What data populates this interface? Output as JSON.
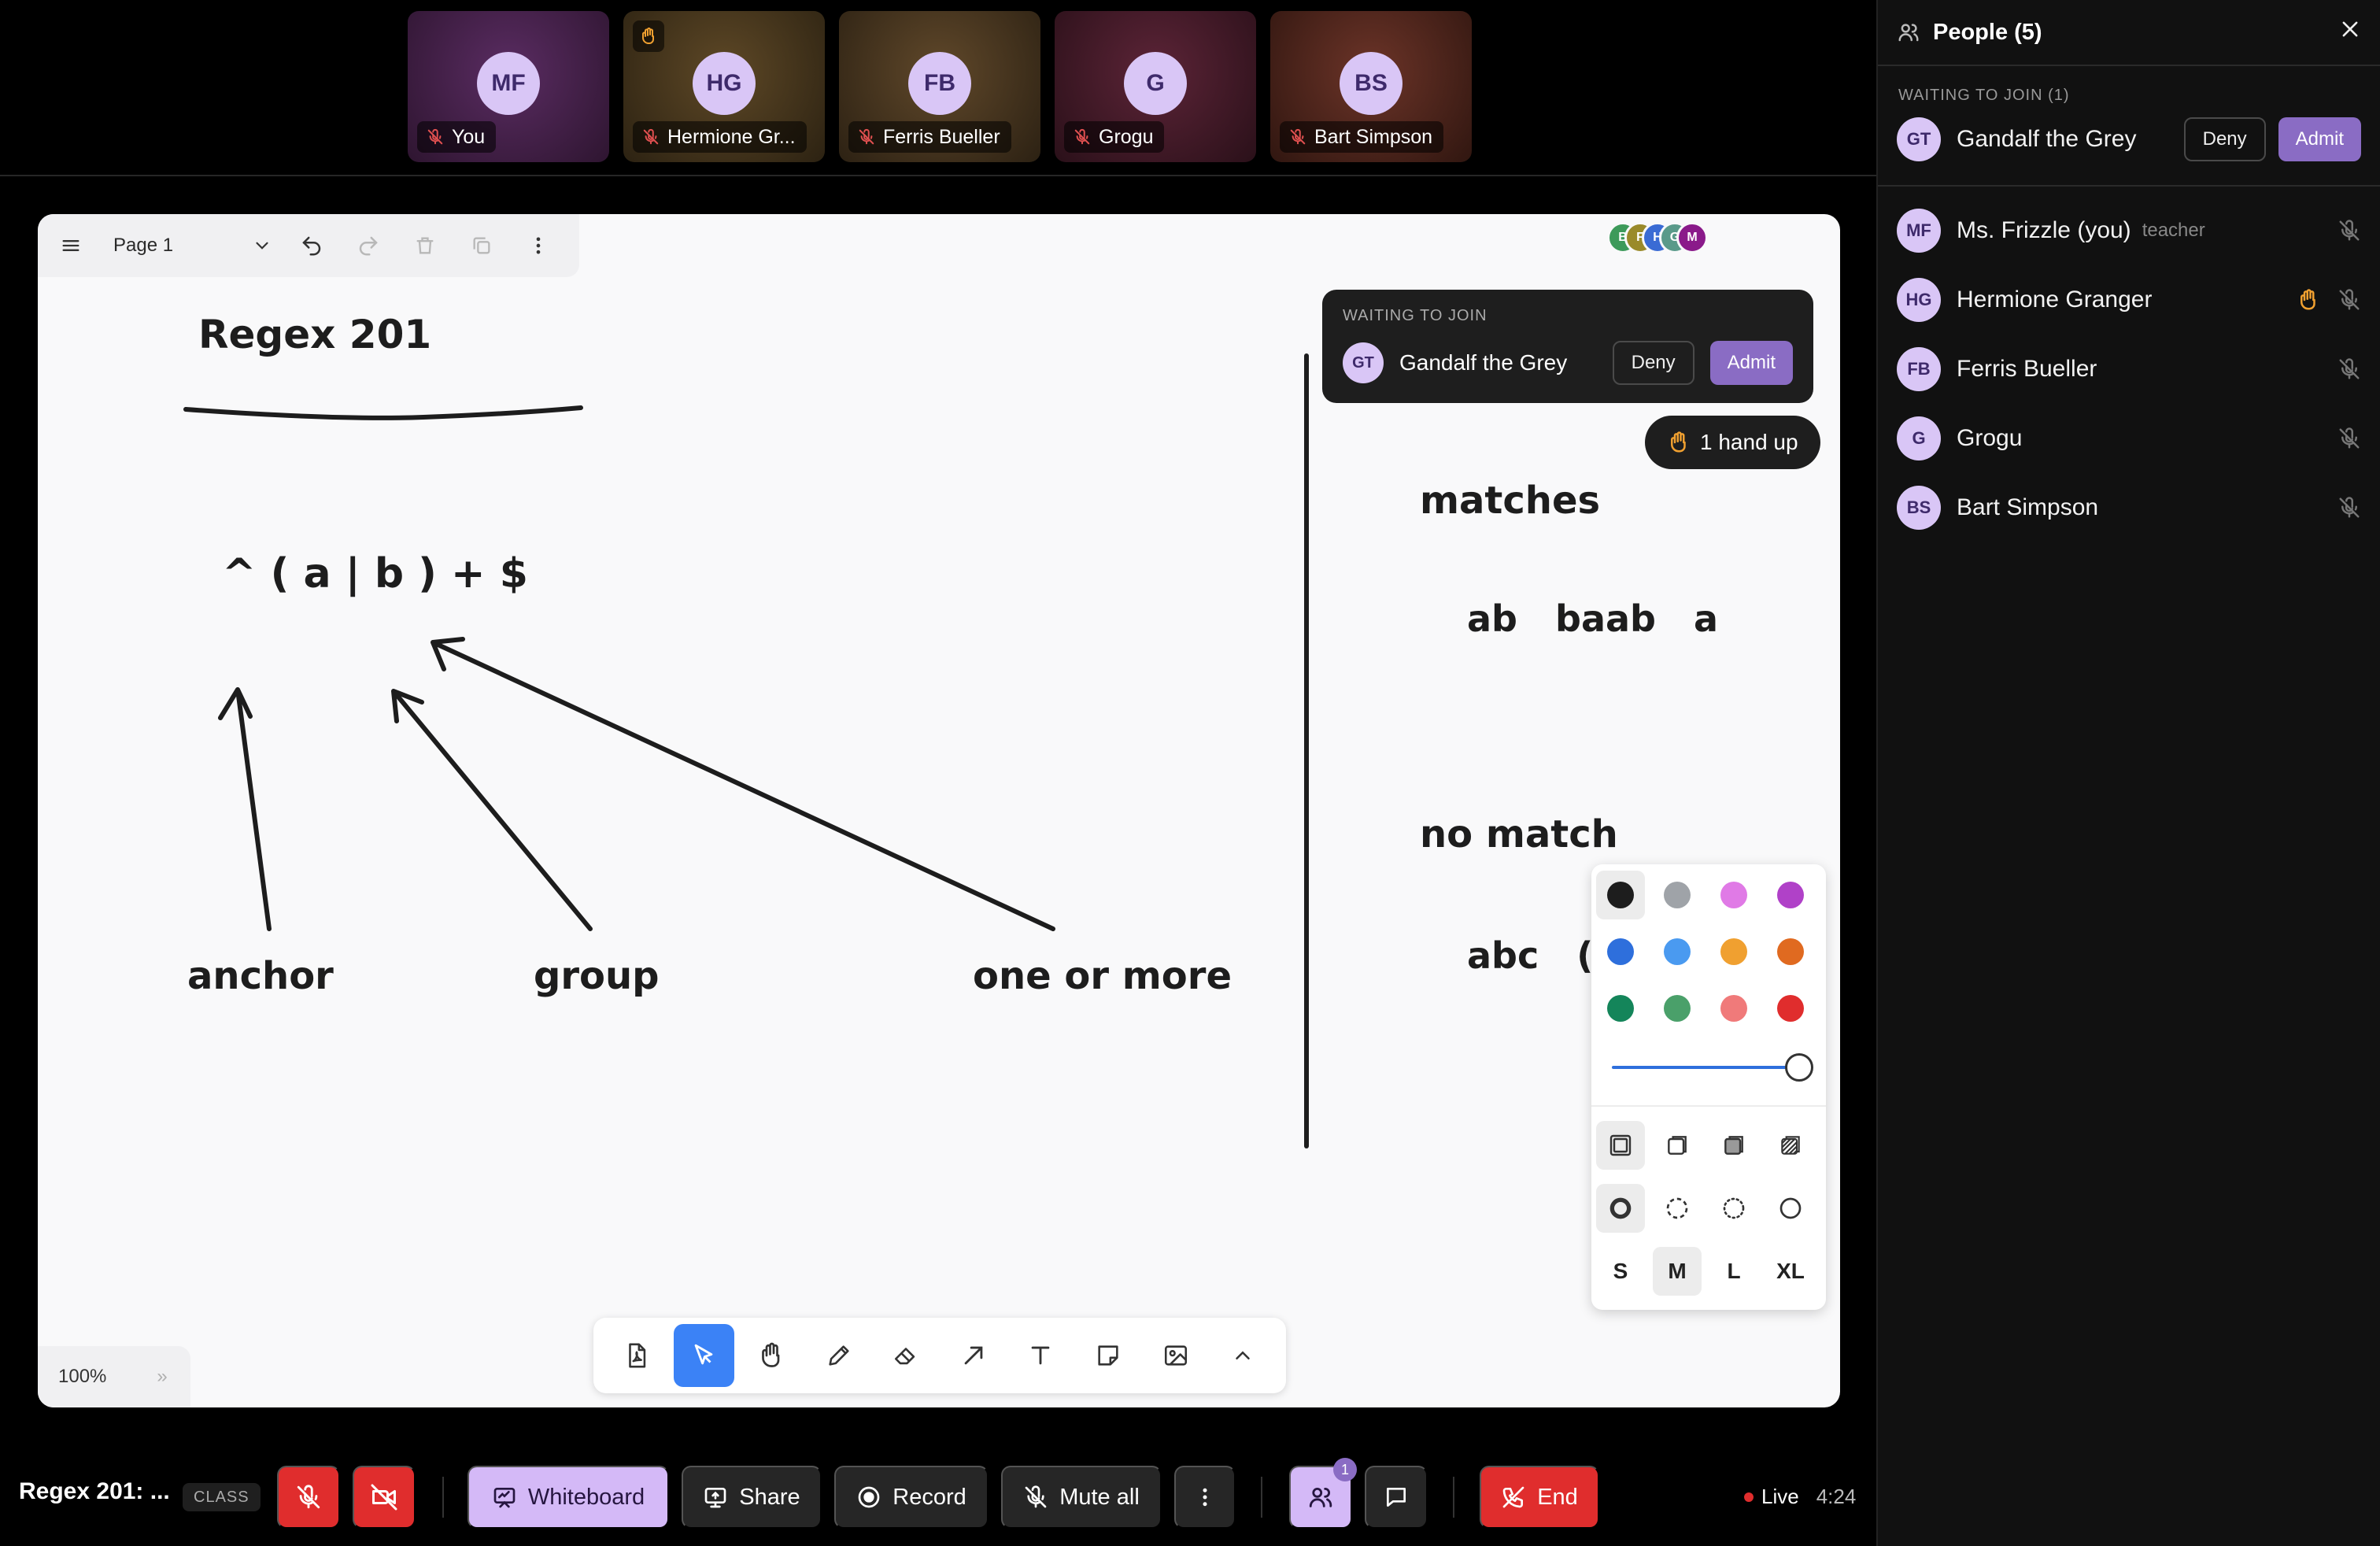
{
  "tiles": [
    {
      "initials": "MF",
      "name": "You",
      "bg": "#4a2352",
      "hand": false
    },
    {
      "initials": "HG",
      "name": "Hermione Gr...",
      "bg": "#4c3a1f",
      "hand": true
    },
    {
      "initials": "FB",
      "name": "Ferris Bueller",
      "bg": "#4e3a22",
      "hand": false
    },
    {
      "initials": "G",
      "name": "Grogu",
      "bg": "#4a1d2c",
      "hand": false
    },
    {
      "initials": "BS",
      "name": "Bart Simpson",
      "bg": "#5a2c22",
      "hand": false
    }
  ],
  "board": {
    "page_label": "Page 1",
    "zoom": "100%",
    "presence": [
      {
        "initials": "B",
        "color": "#3d9a5a"
      },
      {
        "initials": "F",
        "color": "#9a8a2a"
      },
      {
        "initials": "H",
        "color": "#3a6bd4"
      },
      {
        "initials": "G",
        "color": "#5a9a8a"
      },
      {
        "initials": "M",
        "color": "#8a1a8a"
      }
    ],
    "drawing": {
      "title": "Regex 201",
      "regex": "^ ( a | b ) + $",
      "labels": [
        "anchor",
        "group",
        "one or more"
      ],
      "matches_heading": "matches",
      "matches": "ab   baab   a",
      "no_match_heading": "no match",
      "no_match": "abc   (a"
    },
    "waiting_popup": {
      "caption": "WAITING TO JOIN",
      "initials": "GT",
      "name": "Gandalf the Grey",
      "deny": "Deny",
      "admit": "Admit"
    },
    "hands_up": "1 hand up",
    "style_panel": {
      "colors": [
        "#1d1d1d",
        "#9fa3a8",
        "#e07ae6",
        "#b041c8",
        "#2e6fdc",
        "#4a9af0",
        "#f0a030",
        "#e06a20",
        "#14855a",
        "#4aa06a",
        "#f07a7a",
        "#e02d2d"
      ],
      "selected_color": "#1d1d1d",
      "opacity_percent": 100,
      "sizes": [
        "S",
        "M",
        "L",
        "XL"
      ],
      "selected_size": "M"
    },
    "tools": [
      "pdf-tool-icon",
      "select-tool-icon",
      "hand-tool-icon",
      "pencil-tool-icon",
      "eraser-tool-icon",
      "arrow-tool-icon",
      "text-tool-icon",
      "note-tool-icon",
      "image-tool-icon",
      "chevron-up-icon"
    ],
    "selected_tool": "select-tool-icon"
  },
  "bottombar": {
    "title": "Regex 201: ...",
    "tag": "CLASS",
    "whiteboard": "Whiteboard",
    "share": "Share",
    "record": "Record",
    "mute_all": "Mute all",
    "people_badge": "1",
    "end": "End",
    "live": "Live",
    "time": "4:24"
  },
  "panel": {
    "title": "People (5)",
    "waiting_caption": "WAITING TO JOIN (1)",
    "waiting": {
      "initials": "GT",
      "name": "Gandalf the Grey",
      "deny": "Deny",
      "admit": "Admit"
    },
    "people": [
      {
        "initials": "MF",
        "name": "Ms. Frizzle (you)",
        "role": "teacher",
        "hand": false
      },
      {
        "initials": "HG",
        "name": "Hermione Granger",
        "role": "",
        "hand": true
      },
      {
        "initials": "FB",
        "name": "Ferris Bueller",
        "role": "",
        "hand": false
      },
      {
        "initials": "G",
        "name": "Grogu",
        "role": "",
        "hand": false
      },
      {
        "initials": "BS",
        "name": "Bart Simpson",
        "role": "",
        "hand": false
      }
    ]
  },
  "colors": {
    "accent": "#8a6cc4",
    "danger": "#e02d2d",
    "select": "#3b82f6",
    "hand": "#f0a030"
  }
}
